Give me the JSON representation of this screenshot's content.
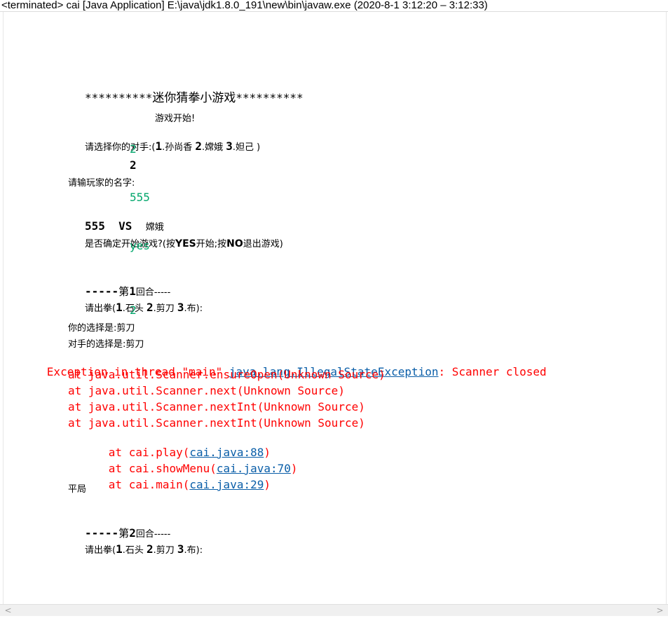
{
  "window": {
    "title": "<terminated> cai [Java Application] E:\\java\\jdk1.8.0_191\\new\\bin\\javaw.exe  (2020-8-1 3:12:20 – 3:12:33)"
  },
  "console": {
    "banner_stars_left": "**********",
    "banner_title": "迷你猜拳小游戏",
    "banner_stars_right": "**********",
    "game_start": "游戏开始!",
    "choose_opponent_prefix": "请选择你的对手:(",
    "opp1_num": "1",
    "opp1_name": ".孙尚香 ",
    "opp2_num": "2",
    "opp2_name": ".嫦娥 ",
    "opp3_num": "3",
    "opp3_name": ".妲己 )",
    "input_opponent": "2",
    "echo_opponent": "2",
    "ask_name": "请输玩家的名字:",
    "input_name": "555",
    "vs_left": "555  VS  ",
    "vs_right": "嫦娥",
    "confirm_prefix": "是否确定开始游戏?(按",
    "confirm_yes": "YES",
    "confirm_mid": "开始;按",
    "confirm_no": "NO",
    "confirm_suffix": "退出游戏)",
    "input_confirm": "yes",
    "round1_dashes": "-----",
    "round1_label_a": "第",
    "round1_num": "1",
    "round1_label_b": "回合-----",
    "punch_prefix": "请出拳(",
    "punch1_num": "1",
    "punch1_name": ".石头 ",
    "punch2_num": "2",
    "punch2_name": ".剪刀 ",
    "punch3_num": "3",
    "punch3_name": ".布):",
    "input_punch": "2",
    "your_choice": "你的选择是:剪刀",
    "opp_choice": "对手的选择是:剪刀",
    "exception_prefix": "Exception in thread \"main\" ",
    "exception_class": "java.lang.IllegalStateException",
    "exception_suffix": ": Scanner closed",
    "stack": [
      "at java.util.Scanner.ensureOpen(Unknown Source)",
      "at java.util.Scanner.next(Unknown Source)",
      "at java.util.Scanner.nextInt(Unknown Source)",
      "at java.util.Scanner.nextInt(Unknown Source)"
    ],
    "stack_play_prefix": "at cai.play(",
    "stack_play_link": "cai.java:88",
    "stack_menu_prefix": "at cai.showMenu(",
    "stack_menu_link": "cai.java:70",
    "stack_main_prefix": "at cai.main(",
    "stack_main_link": "cai.java:29",
    "close_paren": ")",
    "draw": "平局",
    "round2_dashes": "-----",
    "round2_label_a": "第",
    "round2_num": "2",
    "round2_label_b": "回合-----",
    "punch2_prefix": "请出拳(",
    "punch2_1_num": "1",
    "punch2_1_name": ".石头 ",
    "punch2_2_num": "2",
    "punch2_2_name": ".剪刀 ",
    "punch2_3_num": "3",
    "punch2_3_name": ".布):"
  },
  "scrollbar": {
    "left_arrow": "<",
    "right_arrow": ">"
  }
}
